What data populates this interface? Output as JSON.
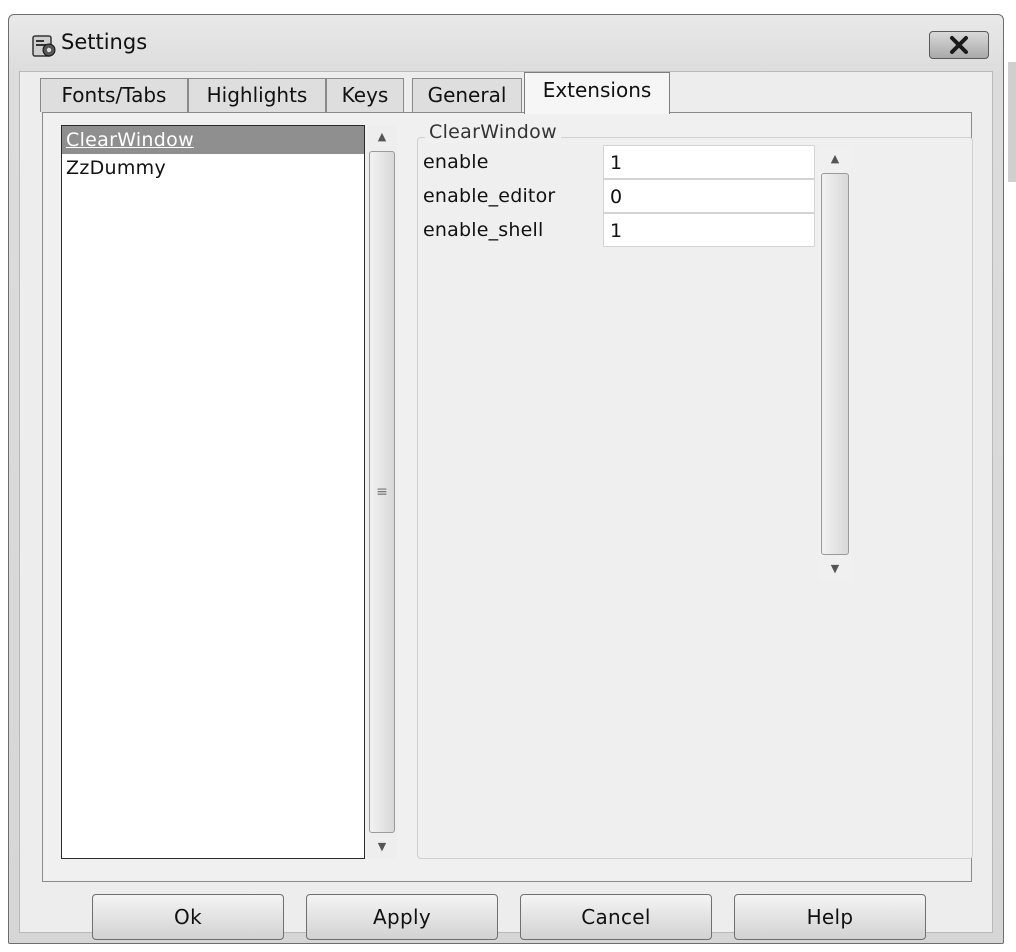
{
  "window": {
    "title": "Settings",
    "icon": "settings-app-icon",
    "close_icon": "close-icon"
  },
  "tabs": [
    {
      "label": "Fonts/Tabs",
      "active": false
    },
    {
      "label": "Highlights",
      "active": false
    },
    {
      "label": "Keys",
      "active": false
    },
    {
      "label": "General",
      "active": false
    },
    {
      "label": "Extensions",
      "active": true
    }
  ],
  "extensions": {
    "items": [
      "ClearWindow",
      "ZzDummy"
    ],
    "selected": "ClearWindow"
  },
  "options": {
    "section_title": "ClearWindow",
    "rows": [
      {
        "label": "enable",
        "value": "1"
      },
      {
        "label": "enable_editor",
        "value": "0"
      },
      {
        "label": "enable_shell",
        "value": "1"
      }
    ]
  },
  "buttons": {
    "ok": "Ok",
    "apply": "Apply",
    "cancel": "Cancel",
    "help": "Help"
  },
  "colors": {
    "selection": "#8f8f8f",
    "window_bg": "#ededed"
  }
}
